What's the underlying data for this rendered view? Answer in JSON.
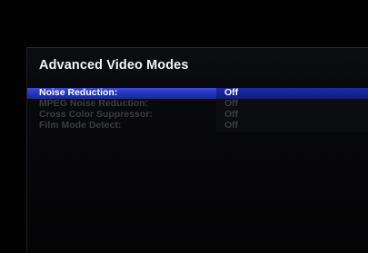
{
  "menu": {
    "title": "Advanced Video Modes",
    "items": [
      {
        "label": "Noise Reduction:",
        "value": "Off",
        "state": "selected"
      },
      {
        "label": "MPEG Noise Reduction:",
        "value": "Off",
        "state": "disabled"
      },
      {
        "label": "Cross Color Suppressor:",
        "value": "Off",
        "state": "disabled"
      },
      {
        "label": "Film Mode Detect:",
        "value": "Off",
        "state": "disabled"
      }
    ]
  },
  "colors": {
    "background": "#020203",
    "highlight": "#2233b8",
    "highlight_value": "#101c7e",
    "text_active": "#ffffff",
    "text_disabled": "#3b3c42",
    "title_text": "#f2f2f2"
  }
}
